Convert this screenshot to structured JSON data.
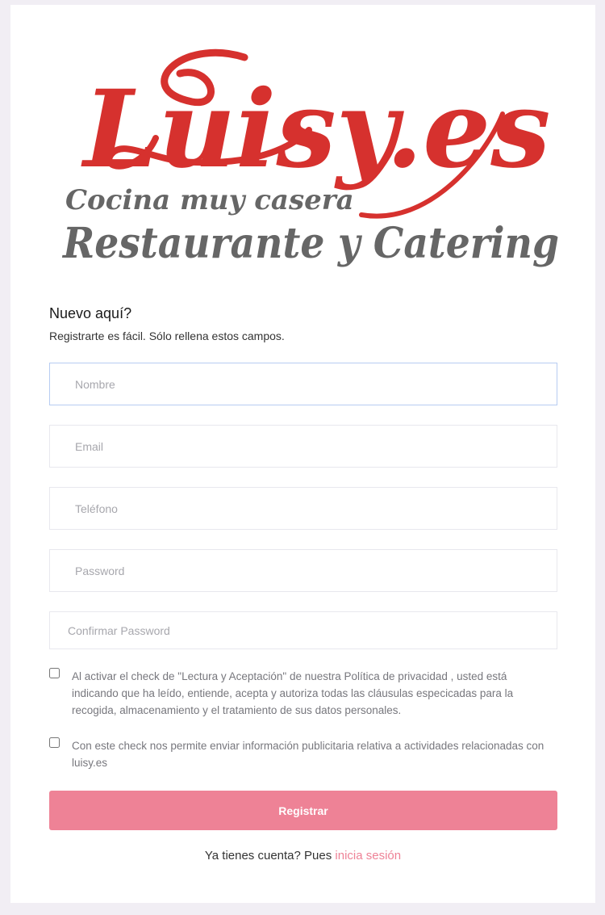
{
  "logo": {
    "wordmark": "Luisy.es",
    "tagline": "Cocina muy casera",
    "subtitle": "Restaurante y Catering",
    "colors": {
      "wordmark": "#d6312e",
      "text": "#666666"
    }
  },
  "form": {
    "heading": "Nuevo aquí?",
    "subheading": "Registrarte es fácil. Sólo rellena estos campos.",
    "fields": {
      "name": {
        "placeholder": "Nombre",
        "value": ""
      },
      "email": {
        "placeholder": "Email",
        "value": ""
      },
      "phone": {
        "placeholder": "Teléfono",
        "value": ""
      },
      "password": {
        "placeholder": "Password",
        "value": ""
      },
      "confirm_password": {
        "placeholder": "Confirmar Password",
        "value": ""
      }
    },
    "checkboxes": {
      "privacy": {
        "checked": false,
        "label": "Al activar el check de \"Lectura y Aceptación\" de nuestra Política de privacidad , usted está indicando que ha leído, entiende, acepta y autoriza todas las cláusulas especicadas para la recogida, almacenamiento y el tratamiento de sus datos personales."
      },
      "marketing": {
        "checked": false,
        "label": "Con este check nos permite enviar información publicitaria relativa a actividades relacionadas con luisy.es"
      }
    },
    "submit_label": "Registrar",
    "login_prompt": "Ya tienes cuenta? Pues",
    "login_link": "inicia sesión"
  },
  "colors": {
    "accent": "#ee8296",
    "background": "#f1eef4",
    "focus_border": "#b7ccf2"
  }
}
